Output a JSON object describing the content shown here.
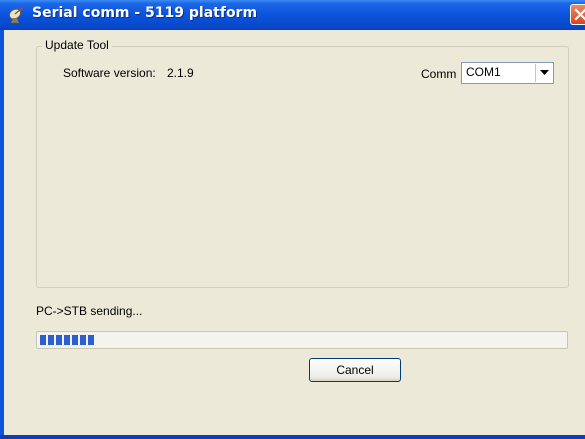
{
  "window": {
    "title": "Serial comm - 5119 platform",
    "title_icon": "satellite-dish-icon",
    "close_icon": "close-x-icon"
  },
  "group": {
    "title": "Update Tool",
    "software_version_label": "Software version:",
    "software_version_value": "2.1.9",
    "comm_label": "Comm",
    "comm_selected": "COM1",
    "dropdown_icon": "chevron-down-icon"
  },
  "status": {
    "text": "PC->STB sending...",
    "progress_blocks": 7,
    "progress_color": "#2d5fcf"
  },
  "buttons": {
    "cancel_label": "Cancel"
  },
  "colors": {
    "titlebar": "#0a54dd",
    "dialog_bg": "#ece9d8",
    "close_button": "#d8451f"
  }
}
